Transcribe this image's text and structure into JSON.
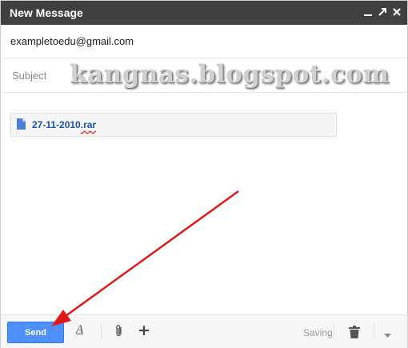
{
  "window": {
    "title": "New Message",
    "controls": {
      "minimize": "minimize-icon",
      "popout": "popout-icon",
      "close": "close-icon"
    }
  },
  "to": {
    "value": "exampletoedu@gmail.com"
  },
  "subject": {
    "placeholder": "Subject",
    "value": ""
  },
  "watermark": "kangnas.blogspot.com",
  "attachment": {
    "name": "27-11-2010",
    "ext": ".rar",
    "icon": "file-icon"
  },
  "toolbar": {
    "send_label": "Send",
    "format_icon": "format-text-icon",
    "attach_icon": "paperclip-icon",
    "more_options_icon": "plus-icon",
    "status": "Saving",
    "trash_icon": "trash-icon",
    "dropdown_icon": "chevron-down-icon"
  },
  "colors": {
    "titlebar": "#404040",
    "send_button": "#4d90fe",
    "attachment_link": "#1a52b3",
    "annotation_arrow": "#e01818"
  }
}
